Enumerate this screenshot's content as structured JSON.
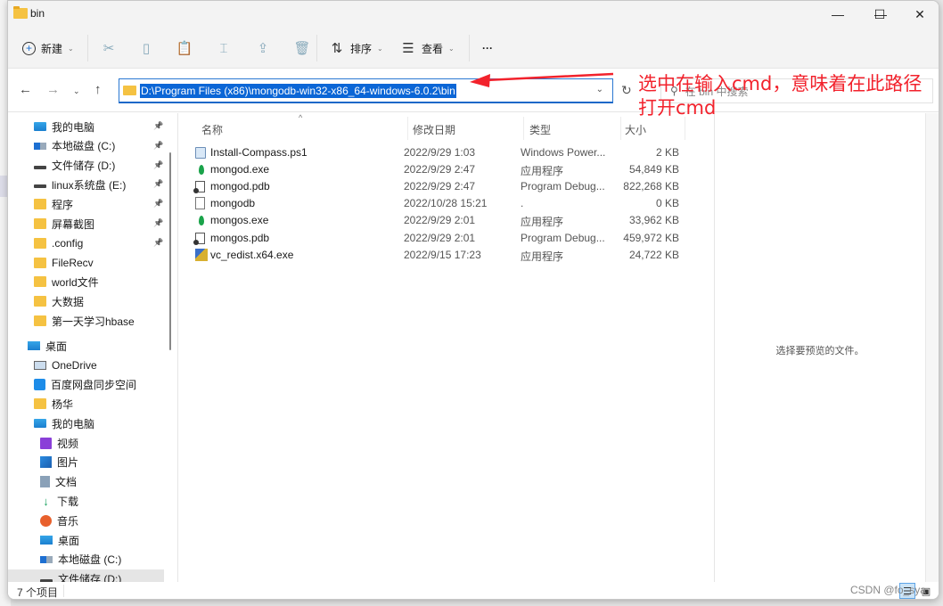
{
  "window": {
    "title": "bin",
    "controls": {
      "minimize": "—",
      "maximize": "☐",
      "close": "✕"
    }
  },
  "toolbar": {
    "new_label": "新建",
    "sort_label": "排序",
    "view_label": "查看",
    "more_label": "···",
    "icons": [
      "cut-icon",
      "copy-icon",
      "paste-icon",
      "rename-icon",
      "share-icon",
      "delete-icon"
    ]
  },
  "addressbar": {
    "path": "D:\\Program Files (x86)\\mongodb-win32-x86_64-windows-6.0.2\\bin",
    "search_placeholder": "在 bin 中搜索"
  },
  "sidebar": {
    "items": [
      {
        "label": "我的电脑",
        "icon": "pc",
        "pinned": true
      },
      {
        "label": "本地磁盘 (C:)",
        "icon": "cdrive",
        "pinned": true
      },
      {
        "label": "文件储存 (D:)",
        "icon": "drive",
        "pinned": true
      },
      {
        "label": "linux系统盘 (E:)",
        "icon": "drive",
        "pinned": true
      },
      {
        "label": "程序",
        "icon": "folder",
        "pinned": true
      },
      {
        "label": "屏幕截图",
        "icon": "folder",
        "pinned": true
      },
      {
        "label": ".config",
        "icon": "folder",
        "pinned": true
      },
      {
        "label": "FileRecv",
        "icon": "folder",
        "pinned": false
      },
      {
        "label": "world文件",
        "icon": "folder",
        "pinned": false
      },
      {
        "label": "大数据",
        "icon": "folder",
        "pinned": false
      },
      {
        "label": "第一天学习hbase",
        "icon": "folder",
        "pinned": false
      }
    ],
    "tree": [
      {
        "label": "桌面",
        "icon": "desk",
        "level": 0
      },
      {
        "label": "OneDrive",
        "icon": "onedrive",
        "level": 1
      },
      {
        "label": "百度网盘同步空间",
        "icon": "baidu",
        "level": 1
      },
      {
        "label": "杨华",
        "icon": "folder",
        "level": 1
      },
      {
        "label": "我的电脑",
        "icon": "pc",
        "level": 1
      },
      {
        "label": "视频",
        "icon": "video",
        "level": 2
      },
      {
        "label": "图片",
        "icon": "pic",
        "level": 2
      },
      {
        "label": "文档",
        "icon": "doc",
        "level": 2
      },
      {
        "label": "下载",
        "icon": "down",
        "level": 2
      },
      {
        "label": "音乐",
        "icon": "music",
        "level": 2
      },
      {
        "label": "桌面",
        "icon": "desk",
        "level": 2
      },
      {
        "label": "本地磁盘 (C:)",
        "icon": "cdrive",
        "level": 2
      },
      {
        "label": "文件储存 (D:)",
        "icon": "drive",
        "level": 2,
        "selected": true
      }
    ]
  },
  "filelist": {
    "columns": {
      "name": "名称",
      "date": "修改日期",
      "type": "类型",
      "size": "大小"
    },
    "rows": [
      {
        "name": "Install-Compass.ps1",
        "date": "2022/9/29 1:03",
        "type": "Windows Power...",
        "size": "2 KB",
        "icon": "ps1"
      },
      {
        "name": "mongod.exe",
        "date": "2022/9/29 2:47",
        "type": "应用程序",
        "size": "54,849 KB",
        "icon": "exe-mongo"
      },
      {
        "name": "mongod.pdb",
        "date": "2022/9/29 2:47",
        "type": "Program Debug...",
        "size": "822,268 KB",
        "icon": "pdb"
      },
      {
        "name": "mongodb",
        "date": "2022/10/28 15:21",
        "type": ".",
        "size": "0 KB",
        "icon": "blank"
      },
      {
        "name": "mongos.exe",
        "date": "2022/9/29 2:01",
        "type": "应用程序",
        "size": "33,962 KB",
        "icon": "exe-mongo"
      },
      {
        "name": "mongos.pdb",
        "date": "2022/9/29 2:01",
        "type": "Program Debug...",
        "size": "459,972 KB",
        "icon": "pdb"
      },
      {
        "name": "vc_redist.x64.exe",
        "date": "2022/9/15 17:23",
        "type": "应用程序",
        "size": "24,722 KB",
        "icon": "vc"
      }
    ]
  },
  "preview": {
    "empty_text": "选择要预览的文件。"
  },
  "statusbar": {
    "count": "7 个项目"
  },
  "annotation": {
    "line1": "选中在输入cmd，意味着在此路径",
    "line2": "打开cmd",
    "color": "#f2222c"
  },
  "watermark": "CSDN @fo_sya"
}
